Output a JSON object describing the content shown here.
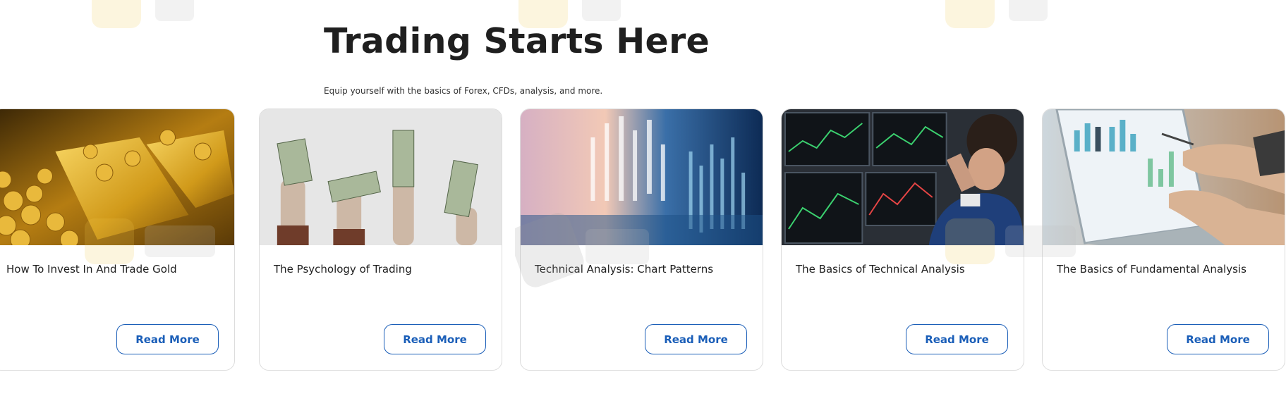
{
  "section": {
    "title": "Trading Starts Here",
    "subtitle": "Equip yourself with the basics of Forex, CFDs, analysis, and more."
  },
  "cards": [
    {
      "title": "How To Invest In And Trade Gold",
      "button": "Read More",
      "image": "gold-bars-image"
    },
    {
      "title": "The Psychology of Trading",
      "button": "Read More",
      "image": "hands-holding-dollars-image"
    },
    {
      "title": "Technical Analysis: Chart Patterns",
      "button": "Read More",
      "image": "chart-candles-image"
    },
    {
      "title": "The Basics of Technical Analysis",
      "button": "Read More",
      "image": "trader-monitors-image"
    },
    {
      "title": "The Basics of Fundamental Analysis",
      "button": "Read More",
      "image": "laptop-analysis-image"
    }
  ],
  "colors": {
    "accent": "#1a5eb8",
    "border": "#dcdcdc",
    "text": "#1f1f1f"
  }
}
